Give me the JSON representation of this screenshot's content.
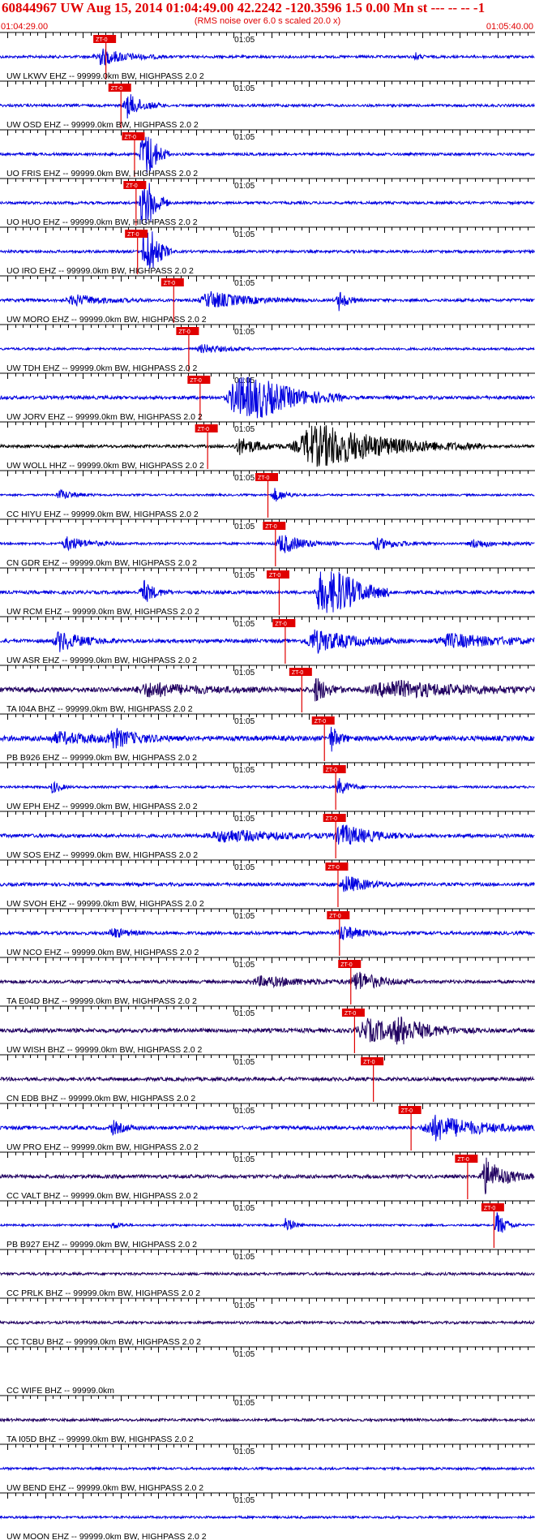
{
  "header": {
    "title": "60844967 UW Aug 15, 2014 01:04:49.00   42.2242 -120.3596  1.5 0.00 Mn st --- -- --  -1",
    "subtitle": "(RMS noise over 6.0 s scaled 20.0 x)",
    "start_time": "01:04:29.00",
    "end_time": "01:05:40.00"
  },
  "colors": {
    "header_text": "#e00000",
    "pick": "#e00000",
    "pick_text": "#ffffff",
    "axis": "#000000",
    "label": "#000000"
  },
  "chart_data": {
    "type": "line",
    "xlim": [
      "01:04:29.00",
      "01:05:40.00"
    ],
    "x_tick_label": "01:05",
    "pick_label": "ZT-0",
    "traces": [
      {
        "label": "UW LKWV EHZ -- 99999.0km BW, HIGHPASS  2.0  2",
        "pick_s": 14.0,
        "color": "#0000e0",
        "amp": 0.16,
        "events": [
          [
            13.5,
            1.0,
            3.5
          ],
          [
            55.0,
            0.6,
            0.6
          ]
        ]
      },
      {
        "label": "UW OSD EHZ -- 99999.0km BW, HIGHPASS  2.0  2",
        "pick_s": 16.0,
        "color": "#0000e0",
        "amp": 0.16,
        "events": [
          [
            17.0,
            1.5,
            2.0
          ]
        ]
      },
      {
        "label": "UO FRIS EHZ -- 99999.0km BW, HIGHPASS  2.0  2",
        "pick_s": 17.8,
        "color": "#0000e0",
        "amp": 0.16,
        "events": [
          [
            19.0,
            5.0,
            1.4
          ]
        ]
      },
      {
        "label": "UO HUO EHZ -- 99999.0km BW, HIGHPASS  2.0  2",
        "pick_s": 18.0,
        "color": "#0000e0",
        "amp": 0.16,
        "events": [
          [
            19.0,
            5.0,
            1.4
          ]
        ]
      },
      {
        "label": "UO IRO EHZ -- 99999.0km BW, HIGHPASS  2.0  2",
        "pick_s": 18.2,
        "color": "#0000e0",
        "amp": 0.16,
        "events": [
          [
            19.3,
            5.0,
            1.4
          ]
        ]
      },
      {
        "label": "UW MORO EHZ -- 99999.0km BW, HIGHPASS  2.0  2",
        "pick_s": 23.0,
        "color": "#0000e0",
        "amp": 0.18,
        "events": [
          [
            28.0,
            1.0,
            5.0
          ],
          [
            45.0,
            1.2,
            1.2
          ],
          [
            10.0,
            0.6,
            4.0
          ]
        ]
      },
      {
        "label": "UW TDH EHZ -- 99999.0km BW, HIGHPASS  2.0  2",
        "pick_s": 25.0,
        "color": "#0000e0",
        "amp": 0.14,
        "events": [
          [
            27.0,
            0.5,
            3.0
          ]
        ]
      },
      {
        "label": "UW JORV EHZ -- 99999.0km BW, HIGHPASS  2.0  2",
        "pick_s": 26.5,
        "color": "#0000e0",
        "amp": 0.2,
        "events": [
          [
            32.0,
            4.0,
            5.5
          ]
        ]
      },
      {
        "label": "UW WOLL HHZ -- 99999.0km BW, HIGHPASS  2.0  2",
        "pick_s": 27.5,
        "color": "#000000",
        "amp": 0.18,
        "events": [
          [
            42.0,
            3.0,
            9.0
          ],
          [
            32.0,
            1.0,
            3.0
          ]
        ]
      },
      {
        "label": "CC HIYU EHZ -- 99999.0km BW, HIGHPASS  2.0  2",
        "pick_s": 35.5,
        "color": "#0000e0",
        "amp": 0.12,
        "events": [
          [
            8.0,
            0.6,
            2.0
          ],
          [
            36.5,
            0.8,
            1.5
          ]
        ]
      },
      {
        "label": "CN GDR EHZ -- 99999.0km BW, HIGHPASS  2.0  2",
        "pick_s": 36.5,
        "color": "#0000e0",
        "amp": 0.14,
        "events": [
          [
            9.0,
            0.8,
            3.0
          ],
          [
            37.5,
            1.2,
            3.0
          ],
          [
            50.0,
            0.7,
            3.0
          ],
          [
            63.0,
            0.5,
            3.0
          ]
        ]
      },
      {
        "label": "UW RCM EHZ -- 99999.0km BW, HIGHPASS  2.0  2",
        "pick_s": 37.0,
        "color": "#0000e0",
        "amp": 0.2,
        "events": [
          [
            43.0,
            5.0,
            3.5
          ],
          [
            19.0,
            1.5,
            1.5
          ]
        ]
      },
      {
        "label": "UW ASR EHZ -- 99999.0km BW, HIGHPASS  2.0  2",
        "pick_s": 37.8,
        "color": "#0000e0",
        "amp": 0.22,
        "events": [
          [
            8.0,
            1.2,
            3.0
          ],
          [
            42.0,
            1.4,
            5.0
          ],
          [
            60.0,
            0.8,
            8.0
          ]
        ]
      },
      {
        "label": "TA I04A BHZ -- 99999.0km BW, HIGHPASS  2.0  2",
        "pick_s": 40.0,
        "color": "#200060",
        "amp": 0.3,
        "events": [
          [
            20.0,
            0.8,
            6.0
          ],
          [
            52.0,
            1.0,
            10.0
          ],
          [
            42.0,
            1.6,
            1.5
          ]
        ]
      },
      {
        "label": "PB B926 EHZ -- 99999.0km BW, HIGHPASS  2.0  2",
        "pick_s": 43.0,
        "color": "#0000e0",
        "amp": 0.3,
        "events": [
          [
            15.0,
            1.0,
            3.0
          ],
          [
            44.0,
            1.5,
            1.0
          ],
          [
            8.0,
            0.6,
            6.0
          ]
        ]
      },
      {
        "label": "UW EPH EHZ -- 99999.0km BW, HIGHPASS  2.0  2",
        "pick_s": 44.5,
        "color": "#0000e0",
        "amp": 0.14,
        "events": [
          [
            7.0,
            0.8,
            1.0
          ],
          [
            45.0,
            1.0,
            1.5
          ]
        ]
      },
      {
        "label": "UW SOS EHZ -- 99999.0km BW, HIGHPASS  2.0  2",
        "pick_s": 44.5,
        "color": "#0000e0",
        "amp": 0.22,
        "events": [
          [
            45.5,
            1.2,
            4.0
          ],
          [
            30.0,
            0.7,
            8.0
          ]
        ]
      },
      {
        "label": "UW SVOH EHZ -- 99999.0km BW, HIGHPASS  2.0  2",
        "pick_s": 44.8,
        "color": "#0000e0",
        "amp": 0.2,
        "events": [
          [
            46.0,
            1.0,
            3.0
          ]
        ]
      },
      {
        "label": "UW NCO EHZ -- 99999.0km BW, HIGHPASS  2.0  2",
        "pick_s": 45.0,
        "color": "#0000e0",
        "amp": 0.2,
        "events": [
          [
            45.5,
            0.9,
            2.5
          ],
          [
            15.0,
            0.6,
            2.0
          ]
        ]
      },
      {
        "label": "TA E04D BHZ -- 99999.0km BW, HIGHPASS  2.0  2",
        "pick_s": 46.5,
        "color": "#200060",
        "amp": 0.2,
        "events": [
          [
            47.5,
            1.2,
            3.0
          ],
          [
            35.0,
            0.6,
            6.0
          ]
        ]
      },
      {
        "label": "UW WISH BHZ -- 99999.0km BW, HIGHPASS  2.0  2",
        "pick_s": 47.0,
        "color": "#200060",
        "amp": 0.25,
        "events": [
          [
            49.0,
            1.3,
            6.0
          ],
          [
            53.0,
            1.2,
            3.0
          ]
        ]
      },
      {
        "label": "CN EDB BHZ -- 99999.0km BW, HIGHPASS  2.0  2",
        "pick_s": 49.5,
        "color": "#200060",
        "amp": 0.22,
        "events": []
      },
      {
        "label": "UW PRO EHZ -- 99999.0km BW, HIGHPASS  2.0  2",
        "pick_s": 54.5,
        "color": "#0000e0",
        "amp": 0.22,
        "events": [
          [
            58.0,
            1.5,
            6.0
          ],
          [
            15.0,
            0.8,
            1.5
          ]
        ]
      },
      {
        "label": "CC VALT BHZ -- 99999.0km BW, HIGHPASS  2.0  2",
        "pick_s": 62.0,
        "color": "#200060",
        "amp": 0.22,
        "events": [
          [
            64.5,
            2.2,
            2.5
          ]
        ]
      },
      {
        "label": "PB B927 EHZ -- 99999.0km BW, HIGHPASS  2.0  2",
        "pick_s": 65.5,
        "color": "#0000e0",
        "amp": 0.12,
        "events": [
          [
            66.0,
            1.6,
            1.2
          ],
          [
            38.0,
            1.0,
            1.0
          ],
          [
            15.0,
            0.5,
            1.0
          ]
        ]
      },
      {
        "label": "CC PRLK BHZ -- 99999.0km BW, HIGHPASS  2.0  2",
        "color": "#200060",
        "amp": 0.16,
        "events": []
      },
      {
        "label": "CC TCBU BHZ -- 99999.0km BW, HIGHPASS  2.0  2",
        "color": "#200060",
        "amp": 0.16,
        "events": []
      },
      {
        "label": "CC WIFE BHZ -- 99999.0km",
        "color": "#200060",
        "amp": 0.0,
        "events": []
      },
      {
        "label": "TA I05D BHZ -- 99999.0km BW, HIGHPASS  2.0  2",
        "color": "#200060",
        "amp": 0.16,
        "events": []
      },
      {
        "label": "UW BEND EHZ -- 99999.0km BW, HIGHPASS  2.0  2",
        "color": "#0000e0",
        "amp": 0.14,
        "events": []
      },
      {
        "label": "UW MOON EHZ -- 99999.0km BW, HIGHPASS  2.0  2",
        "color": "#0000e0",
        "amp": 0.14,
        "events": []
      }
    ]
  }
}
